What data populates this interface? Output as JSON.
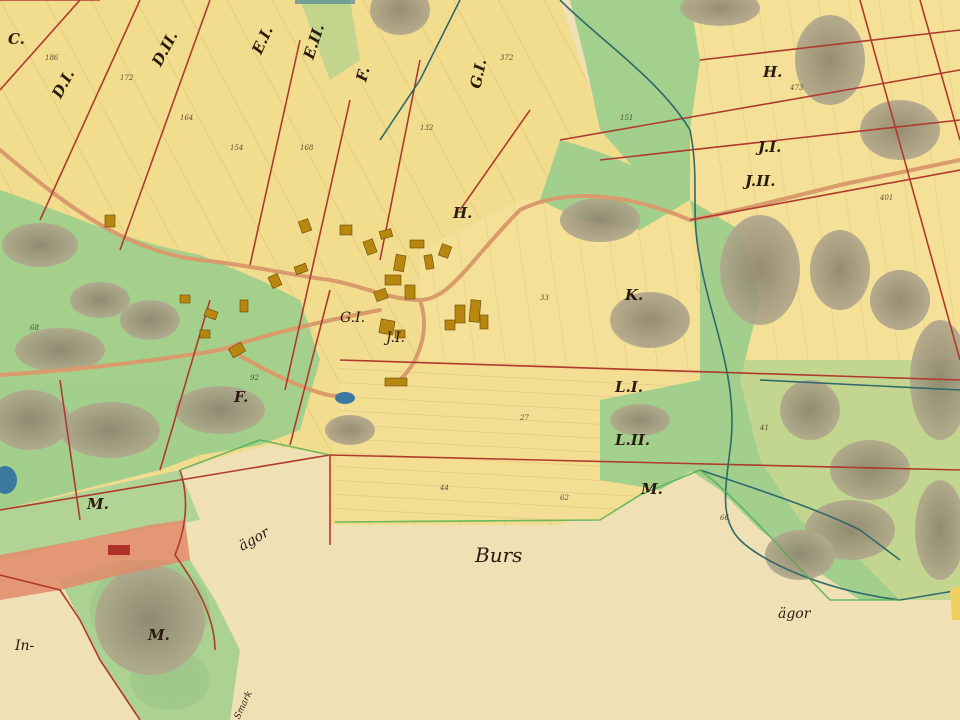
{
  "map": {
    "place_names": {
      "burs": "Burs",
      "agor_center": "ägor",
      "agor_right": "ägor",
      "in_left": "In-",
      "edge_bottom": "Smark"
    },
    "parcel_labels": {
      "c": "C.",
      "d1": "D.I.",
      "d2": "D.II.",
      "e1": "E.I.",
      "e2": "E.II.",
      "f_top": "F.",
      "g1_top": "G.I.",
      "h_mid": "H.",
      "h_right": "H.",
      "j1": "J.I.",
      "j2": "J.II.",
      "gi_village": "G.I.",
      "ji_village": "J.I.",
      "k": "K.",
      "l1": "L.I.",
      "l2": "L.II.",
      "m_mid": "M.",
      "m_left": "M.",
      "m_bottom": "M.",
      "f_left": "F."
    },
    "colors": {
      "paper": "#efe0b6",
      "field_yellow": "#f2dc8e",
      "meadow_green": "#9fcf8c",
      "rock_grey": "#9a8f78",
      "property_red": "#b03a2e",
      "road_orange": "#d99a6c",
      "water_blue": "#3a7aa0",
      "house_brown": "#b8870f"
    }
  }
}
